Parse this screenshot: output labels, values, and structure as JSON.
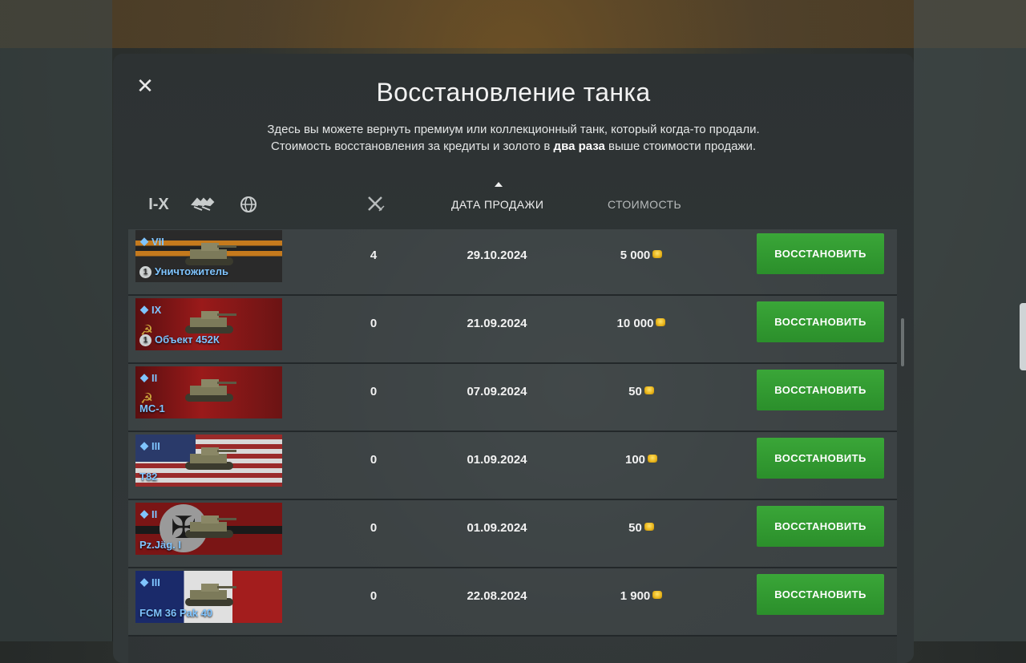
{
  "modal": {
    "title": "Восстановление танка",
    "description_line1": "Здесь вы можете вернуть премиум или коллекционный танк, который когда-то продали.",
    "description_line2_before": "Стоимость восстановления за кредиты и золото в ",
    "description_line2_bold": "два раза",
    "description_line2_after": " выше стоимости продажи."
  },
  "filters": {
    "tier_label": "I-X"
  },
  "columns": {
    "sale_date": "ДАТА ПРОДАЖИ",
    "cost": "СТОИМОСТЬ"
  },
  "colors": {
    "accent_green": "#34a034",
    "tank_name_blue": "#7fc4ff"
  },
  "tanks": [
    {
      "tier": "VII",
      "name": "Уничтожитель",
      "mastery": "1",
      "battles": "4",
      "date": "29.10.2024",
      "cost": "5 000",
      "button": "ВОССТАНОВИТЬ",
      "flag": "ribbon"
    },
    {
      "tier": "IX",
      "name": "Объект 452К",
      "mastery": "1",
      "battles": "0",
      "date": "21.09.2024",
      "cost": "10 000",
      "button": "ВОССТАНОВИТЬ",
      "flag": "ussr"
    },
    {
      "tier": "II",
      "name": "МС-1",
      "mastery": "",
      "battles": "0",
      "date": "07.09.2024",
      "cost": "50",
      "button": "ВОССТАНОВИТЬ",
      "flag": "ussr"
    },
    {
      "tier": "III",
      "name": "T82",
      "mastery": "",
      "battles": "0",
      "date": "01.09.2024",
      "cost": "100",
      "button": "ВОССТАНОВИТЬ",
      "flag": "usa"
    },
    {
      "tier": "II",
      "name": "Pz.Jäg. I",
      "mastery": "",
      "battles": "0",
      "date": "01.09.2024",
      "cost": "50",
      "button": "ВОССТАНОВИТЬ",
      "flag": "germany"
    },
    {
      "tier": "III",
      "name": "FCM 36 Pak 40",
      "mastery": "",
      "battles": "0",
      "date": "22.08.2024",
      "cost": "1 900",
      "button": "ВОССТАНОВИТЬ",
      "flag": "france"
    }
  ]
}
